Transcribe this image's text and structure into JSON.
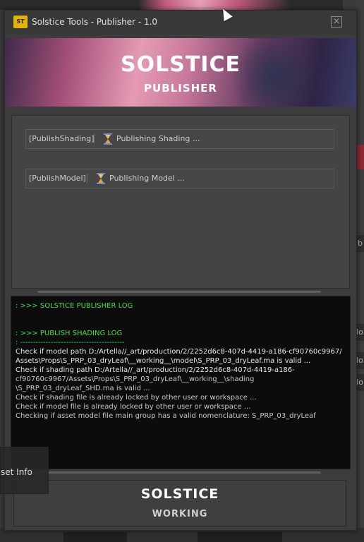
{
  "window": {
    "title": "Solstice Tools - Publisher - 1.0",
    "close_glyph": "✕"
  },
  "banner": {
    "logo": "SOLSTICE",
    "subtitle": "PUBLISHER"
  },
  "tasks": [
    {
      "name": "[PublishShading]",
      "status": "Publishing Shading ...",
      "icon": "hourglass-icon"
    },
    {
      "name": "[PublishModel]",
      "status": "Publishing Model ...",
      "icon": "hourglass-icon"
    }
  ],
  "log": {
    "lines": [
      ": >>> SOLSTICE PUBLISHER LOG",
      ": >>> PUBLISH SHADING LOG",
      ": -----------------------------------------",
      "Check if model path D:/Artella//_art/production/2/2252d6c8-407d-4419-a186-cf90760c9967/",
      "Assets\\Props\\S_PRP_03_dryLeaf\\__working__\\model\\S_PRP_03_dryLeaf.ma is valid ...",
      "Check if shading path D:/Artella//_art/production/2/2252d6c8-407d-4419-a186-",
      "cf90760c9967/Assets\\Props\\S_PRP_03_dryLeaf\\__working__\\shading",
      "\\S_PRP_03_dryLeaf_SHD.ma is valid ...",
      "Check if shading file is already locked by other user or workspace ...",
      "Check if model file is already locked by other user or workspace ...",
      "Checking if asset model file main group has a valid nomenclature: S_PRP_03_dryLeaf"
    ]
  },
  "footer": {
    "logo": "SOLSTICE",
    "status": "WORKING"
  },
  "background": {
    "asset_info_label": "set Info",
    "right_strip": [
      "ub",
      "No",
      "No",
      "No"
    ]
  },
  "colors": {
    "log_green": "#3fe04a",
    "banner_pink": "#e59bb4",
    "app_icon_yellow": "#e5b400"
  }
}
